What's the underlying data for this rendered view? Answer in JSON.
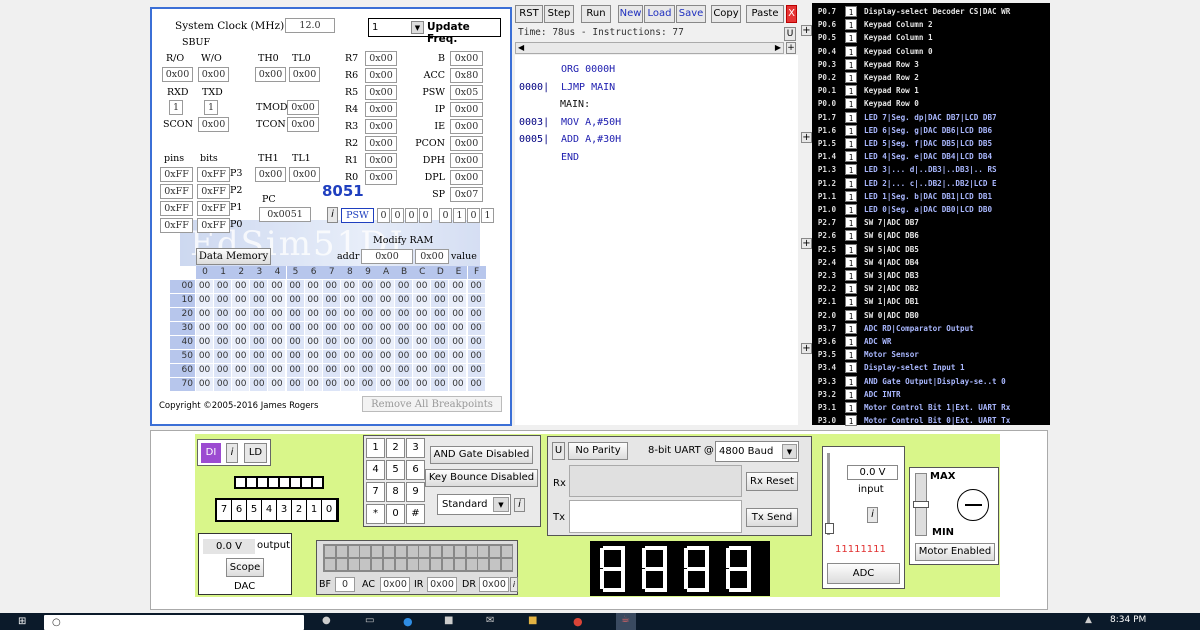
{
  "panel": {
    "clock_label": "System Clock  (MHz)",
    "clock_value": "12.0",
    "freq_select": "1",
    "update_freq": "Update Freq.",
    "sbuf": "SBUF",
    "ro": "R/O",
    "wo": "W/O",
    "ro_val": "0x00",
    "wo_val": "0x00",
    "rxd": "RXD",
    "txd": "TXD",
    "rxd_val": "1",
    "txd_val": "1",
    "scon": "SCON",
    "scon_val": "0x00",
    "th0": "TH0",
    "tl0": "TL0",
    "th0_val": "0x00",
    "tl0_val": "0x00",
    "tmod": "TMOD",
    "tmod_val": "0x00",
    "tcon": "TCON",
    "tcon_val": "0x00",
    "th1": "TH1",
    "tl1": "TL1",
    "th1_val": "0x00",
    "tl1_val": "0x00",
    "pins": "pins",
    "bits": "bits",
    "ports": [
      {
        "name": "P3",
        "pins": "0xFF",
        "bits": "0xFF"
      },
      {
        "name": "P2",
        "pins": "0xFF",
        "bits": "0xFF"
      },
      {
        "name": "P1",
        "pins": "0xFF",
        "bits": "0xFF"
      },
      {
        "name": "P0",
        "pins": "0xFF",
        "bits": "0xFF"
      }
    ],
    "regs_left": [
      {
        "n": "R7",
        "v": "0x00"
      },
      {
        "n": "R6",
        "v": "0x00"
      },
      {
        "n": "R5",
        "v": "0x00"
      },
      {
        "n": "R4",
        "v": "0x00"
      },
      {
        "n": "R3",
        "v": "0x00"
      },
      {
        "n": "R2",
        "v": "0x00"
      },
      {
        "n": "R1",
        "v": "0x00"
      },
      {
        "n": "R0",
        "v": "0x00"
      }
    ],
    "regs_right": [
      {
        "n": "B",
        "v": "0x00"
      },
      {
        "n": "ACC",
        "v": "0x80"
      },
      {
        "n": "PSW",
        "v": "0x05"
      },
      {
        "n": "IP",
        "v": "0x00"
      },
      {
        "n": "IE",
        "v": "0x00"
      },
      {
        "n": "PCON",
        "v": "0x00"
      },
      {
        "n": "DPH",
        "v": "0x00"
      },
      {
        "n": "DPL",
        "v": "0x00"
      },
      {
        "n": "SP",
        "v": "0x07"
      }
    ],
    "pc": "PC",
    "pc_val": "0x0051",
    "chip": "8051",
    "psw": "PSW",
    "psw_bits": [
      "0",
      "0",
      "0",
      "0",
      "0",
      "1",
      "0",
      "1"
    ],
    "info": "i",
    "modify_ram": "Modify RAM",
    "data_memory": "Data Memory",
    "addr": "addr",
    "addr_val": "0x00",
    "value_val": "0x00",
    "value": "value",
    "watermark": "EdSim51DI",
    "mem_cols": [
      "0",
      "1",
      "2",
      "3",
      "4",
      "5",
      "6",
      "7",
      "8",
      "9",
      "A",
      "B",
      "C",
      "D",
      "E",
      "F"
    ],
    "mem_rows": [
      {
        "addr": "00",
        "cells": [
          "00",
          "00",
          "00",
          "00",
          "00",
          "00",
          "00",
          "00",
          "00",
          "00",
          "00",
          "00",
          "00",
          "00",
          "00",
          "00"
        ]
      },
      {
        "addr": "10",
        "cells": [
          "00",
          "00",
          "00",
          "00",
          "00",
          "00",
          "00",
          "00",
          "00",
          "00",
          "00",
          "00",
          "00",
          "00",
          "00",
          "00"
        ]
      },
      {
        "addr": "20",
        "cells": [
          "00",
          "00",
          "00",
          "00",
          "00",
          "00",
          "00",
          "00",
          "00",
          "00",
          "00",
          "00",
          "00",
          "00",
          "00",
          "00"
        ]
      },
      {
        "addr": "30",
        "cells": [
          "00",
          "00",
          "00",
          "00",
          "00",
          "00",
          "00",
          "00",
          "00",
          "00",
          "00",
          "00",
          "00",
          "00",
          "00",
          "00"
        ]
      },
      {
        "addr": "40",
        "cells": [
          "00",
          "00",
          "00",
          "00",
          "00",
          "00",
          "00",
          "00",
          "00",
          "00",
          "00",
          "00",
          "00",
          "00",
          "00",
          "00"
        ]
      },
      {
        "addr": "50",
        "cells": [
          "00",
          "00",
          "00",
          "00",
          "00",
          "00",
          "00",
          "00",
          "00",
          "00",
          "00",
          "00",
          "00",
          "00",
          "00",
          "00"
        ]
      },
      {
        "addr": "60",
        "cells": [
          "00",
          "00",
          "00",
          "00",
          "00",
          "00",
          "00",
          "00",
          "00",
          "00",
          "00",
          "00",
          "00",
          "00",
          "00",
          "00"
        ]
      },
      {
        "addr": "70",
        "cells": [
          "00",
          "00",
          "00",
          "00",
          "00",
          "00",
          "00",
          "00",
          "00",
          "00",
          "00",
          "00",
          "00",
          "00",
          "00",
          "00"
        ]
      }
    ],
    "copyright": "Copyright ©2005-2016 James Rogers",
    "remove_bp": "Remove All Breakpoints"
  },
  "toolbar": {
    "buttons": [
      "RST",
      "Step",
      "Run",
      "New",
      "Load",
      "Save",
      "Copy",
      "Paste"
    ],
    "close": "X",
    "status": "Time: 78us - Instructions: 77",
    "u": "U"
  },
  "code": [
    {
      "addr": "",
      "text": "ORG 0000H"
    },
    {
      "addr": "0000|",
      "text": "LJMP MAIN"
    },
    {
      "addr": "",
      "text": "MAIN:"
    },
    {
      "addr": "0003|",
      "text": "MOV A,#50H"
    },
    {
      "addr": "0005|",
      "text": "ADD A,#30H"
    },
    {
      "addr": "",
      "text": "END"
    }
  ],
  "port_pins": [
    {
      "pin": "P0.7",
      "val": "1",
      "desc": "Display-select Decoder CS|DAC WR"
    },
    {
      "pin": "P0.6",
      "val": "1",
      "desc": "Keypad Column 2"
    },
    {
      "pin": "P0.5",
      "val": "1",
      "desc": "Keypad Column 1"
    },
    {
      "pin": "P0.4",
      "val": "1",
      "desc": "Keypad Column 0"
    },
    {
      "pin": "P0.3",
      "val": "1",
      "desc": "Keypad Row 3"
    },
    {
      "pin": "P0.2",
      "val": "1",
      "desc": "Keypad Row 2"
    },
    {
      "pin": "P0.1",
      "val": "1",
      "desc": "Keypad Row 1"
    },
    {
      "pin": "P0.0",
      "val": "1",
      "desc": "Keypad Row 0"
    },
    {
      "pin": "P1.7",
      "val": "1",
      "desc": "LED 7|Seg. dp|DAC DB7|LCD DB7"
    },
    {
      "pin": "P1.6",
      "val": "1",
      "desc": "LED 6|Seg. g|DAC DB6|LCD DB6"
    },
    {
      "pin": "P1.5",
      "val": "1",
      "desc": "LED 5|Seg. f|DAC DB5|LCD DB5"
    },
    {
      "pin": "P1.4",
      "val": "1",
      "desc": "LED 4|Seg. e|DAC DB4|LCD DB4"
    },
    {
      "pin": "P1.3",
      "val": "1",
      "desc": "LED 3|... d|..DB3|..DB3|.. RS"
    },
    {
      "pin": "P1.2",
      "val": "1",
      "desc": "LED 2|... c|..DB2|..DB2|LCD E"
    },
    {
      "pin": "P1.1",
      "val": "1",
      "desc": "LED 1|Seg. b|DAC DB1|LCD DB1"
    },
    {
      "pin": "P1.0",
      "val": "1",
      "desc": "LED 0|Seg. a|DAC DB0|LCD DB0"
    },
    {
      "pin": "P2.7",
      "val": "1",
      "desc": "SW 7|ADC DB7"
    },
    {
      "pin": "P2.6",
      "val": "1",
      "desc": "SW 6|ADC DB6"
    },
    {
      "pin": "P2.5",
      "val": "1",
      "desc": "SW 5|ADC DB5"
    },
    {
      "pin": "P2.4",
      "val": "1",
      "desc": "SW 4|ADC DB4"
    },
    {
      "pin": "P2.3",
      "val": "1",
      "desc": "SW 3|ADC DB3"
    },
    {
      "pin": "P2.2",
      "val": "1",
      "desc": "SW 2|ADC DB2"
    },
    {
      "pin": "P2.1",
      "val": "1",
      "desc": "SW 1|ADC DB1"
    },
    {
      "pin": "P2.0",
      "val": "1",
      "desc": "SW 0|ADC DB0"
    },
    {
      "pin": "P3.7",
      "val": "1",
      "desc": "ADC RD|Comparator Output"
    },
    {
      "pin": "P3.6",
      "val": "1",
      "desc": "ADC WR"
    },
    {
      "pin": "P3.5",
      "val": "1",
      "desc": "Motor Sensor"
    },
    {
      "pin": "P3.4",
      "val": "1",
      "desc": "Display-select Input 1"
    },
    {
      "pin": "P3.3",
      "val": "1",
      "desc": "AND Gate Output|Display-se..t 0"
    },
    {
      "pin": "P3.2",
      "val": "1",
      "desc": "ADC INTR"
    },
    {
      "pin": "P3.1",
      "val": "1",
      "desc": "Motor Control Bit 1|Ext. UART Rx"
    },
    {
      "pin": "P3.0",
      "val": "1",
      "desc": "Motor Control Bit 0|Ext. UART Tx"
    }
  ],
  "peripherals": {
    "di": "DI",
    "info": "i",
    "ld": "LD",
    "switches": [
      "7",
      "6",
      "5",
      "4",
      "3",
      "2",
      "1",
      "0"
    ],
    "dac_val": "0.0 V",
    "output": "output",
    "scope": "Scope",
    "dac": "DAC",
    "keypad": [
      "1",
      "2",
      "3",
      "4",
      "5",
      "6",
      "7",
      "8",
      "9",
      "*",
      "0",
      "#"
    ],
    "and_gate": "AND Gate Disabled",
    "key_bounce": "Key Bounce Disabled",
    "standard": "Standard",
    "bf": "BF",
    "bf_val": "0",
    "ac": "AC",
    "ac_val": "0x00",
    "ir": "IR",
    "ir_val": "0x00",
    "dr": "DR",
    "dr_val": "0x00",
    "u": "U",
    "parity": "No Parity",
    "uart_label": "8-bit UART @",
    "baud": "4800 Baud",
    "rx": "Rx",
    "tx": "Tx",
    "rx_reset": "Rx Reset",
    "tx_send": "Tx Send",
    "adc_val": "0.0 V",
    "input": "input",
    "adc_bits": "11111111",
    "adc": "ADC",
    "max": "MAX",
    "min": "MIN",
    "motor": "Motor Enabled"
  },
  "taskbar": {
    "time": "8:34 PM"
  },
  "colors": {
    "accent": "#3b6fd6",
    "green": "#d9f68a",
    "code_addr": "#000080",
    "code_text": "#2020b0",
    "led_on": "#ffffff"
  }
}
